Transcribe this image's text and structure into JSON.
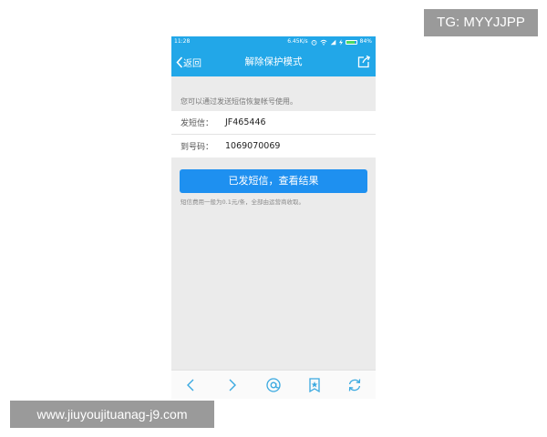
{
  "status_bar": {
    "time": "11:28",
    "speed": "6.45K/s",
    "battery": "84%",
    "battery_level": 0.84,
    "icons": [
      "alarm-icon",
      "wifi-icon",
      "signal-icon",
      "charging-icon",
      "battery-icon"
    ]
  },
  "nav": {
    "back_label": "返回",
    "title": "解除保护模式",
    "icons": [
      "chevron-left-icon",
      "share-icon"
    ]
  },
  "hint": "您可以通过发送短信恢复帐号使用。",
  "sms": {
    "content_label": "发短信：",
    "content_value": "JF465446",
    "number_label": "到号码：",
    "number_value": "1069070069"
  },
  "action_button": "已发短信，查看结果",
  "fee_note": "短信费用一般为0.1元/条，全部由运营商收取。",
  "bottom_bar": {
    "icons": [
      "back-arrow-icon",
      "forward-arrow-icon",
      "at-home-icon",
      "bookmark-star-icon",
      "refresh-icon"
    ]
  },
  "watermarks": {
    "top": "TG: MYYJJPP",
    "bottom": "www.jiuyoujituanag-j9.com"
  },
  "colors": {
    "header_blue": "#22a7e8",
    "button_blue": "#1e90f0",
    "background_gray": "#ebebeb",
    "icon_blue": "#3aa9e0"
  }
}
